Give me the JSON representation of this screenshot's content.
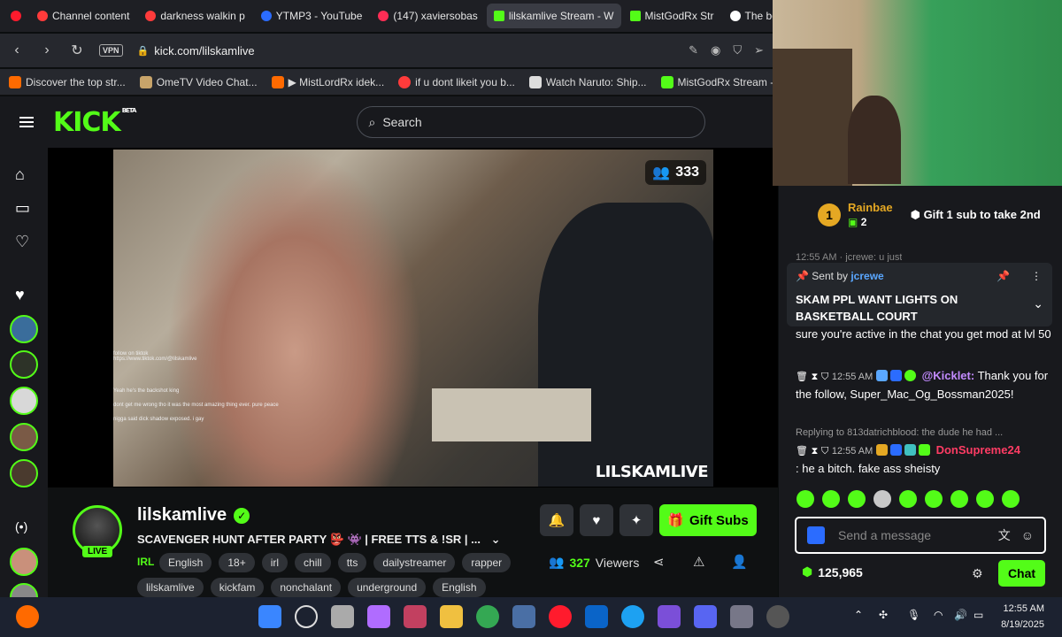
{
  "browser": {
    "tabs": [
      {
        "label": "Channel content",
        "color": "#ff3b3b"
      },
      {
        "label": "darkness walkin p",
        "color": "#ff3b3b"
      },
      {
        "label": "YTMP3 - YouTube",
        "color": "#2b6cff"
      },
      {
        "label": "(147) xaviersobas",
        "color": "#ff2d55"
      },
      {
        "label": "lilskamlive Stream - W",
        "color": "#53fc18"
      },
      {
        "label": "MistGodRx Str",
        "color": "#53fc18"
      },
      {
        "label": "The best ChatB",
        "color": "#ffffff"
      }
    ],
    "url": "kick.com/lilskamlive",
    "vpn_label": "VPN",
    "bookmarks": [
      {
        "label": "Discover the top str...",
        "color": "#ff6a00"
      },
      {
        "label": "OmeTV Video Chat...",
        "color": "#c8a46a"
      },
      {
        "label": "▶ MistLordRx idek...",
        "color": "#ff6a00"
      },
      {
        "label": "if u dont likeit you b...",
        "color": "#ff3b3b"
      },
      {
        "label": "Watch Naruto: Ship...",
        "color": "#dddddd"
      },
      {
        "label": "MistGodRx Stream -...",
        "color": "#53fc18"
      }
    ]
  },
  "kick": {
    "logo": "KICK",
    "logo_badge": "BETA",
    "search_placeholder": "Search"
  },
  "stream": {
    "viewer_badge": "333",
    "watermark": "LILSKAMLIVE",
    "overlay_lines": [
      "follow on tiktok",
      "https://www.tiktok.com/@lilskamlive",
      "Yeah he's the backshot king",
      "dont get me wrong tho it was the most amazing thing ever. pure peace",
      "nigga said dick shadow exposed. i gay"
    ],
    "name": "lilskamlive",
    "live_badge": "LIVE",
    "title": "SCAVENGER HUNT AFTER PARTY 👺 👾 | FREE TTS & !SR | ...",
    "category": "IRL",
    "tags_row1": [
      "English",
      "18+",
      "irl",
      "chill",
      "tts",
      "dailystreamer",
      "rapper"
    ],
    "tags_row2": [
      "lilskamlive",
      "kickfam",
      "nonchalant",
      "underground",
      "English"
    ],
    "gift_label": "Gift Subs",
    "viewers_count": "327",
    "viewers_label": "Viewers"
  },
  "chat": {
    "leader_name": "Rainbae",
    "leader_rank": "1",
    "leader_count": "2",
    "leader_cta": "Gift 1 sub to take 2nd",
    "partial_top": "12:55 AM · jcrewe: u just",
    "pinned_by": "Sent by",
    "pinned_user": "jcrewe",
    "pinned_text": "SKAM PPL WANT LIGHTS ON BASKETBALL COURT",
    "msg1_cont": "sure you're active in the chat you get mod at lvl 50",
    "msg2_time": "12:55 AM",
    "msg2_user": "@Kicklet:",
    "msg2_text": "Thank you for the follow, Super_Mac_Og_Bossman2025!",
    "reply_to": "Replying to 813datrichblood: the dude he had ...",
    "msg3_time": "12:55 AM",
    "msg3_user": "DonSupreme24",
    "msg3_text": ": he a bitch. fake ass sheisty",
    "input_placeholder": "Send a message",
    "points": "125,965",
    "chat_button": "Chat"
  },
  "taskbar": {
    "time": "12:55 AM",
    "date": "8/19/2025"
  }
}
